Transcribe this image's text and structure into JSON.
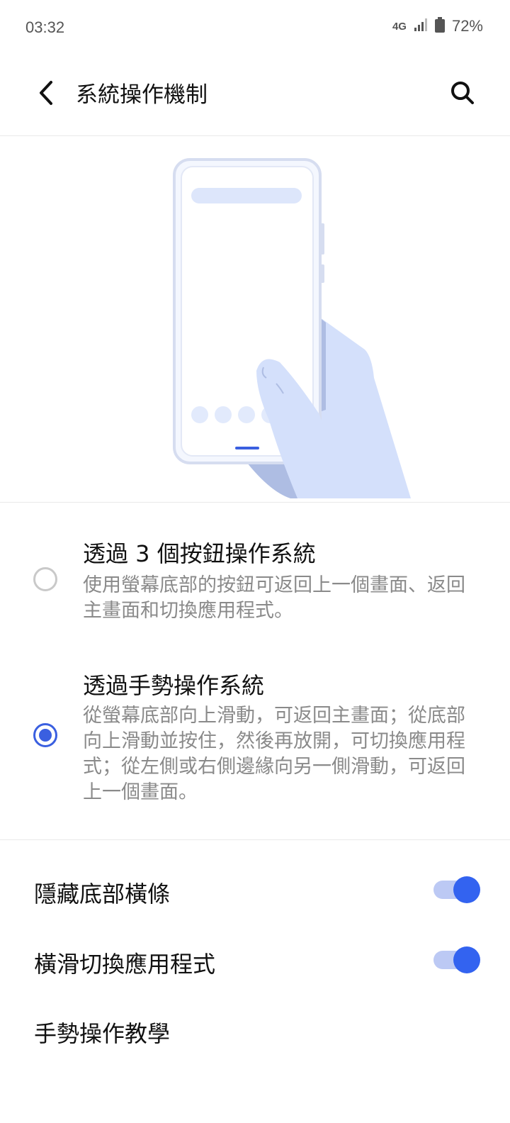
{
  "status_bar": {
    "time": "03:32",
    "network": "4G",
    "battery_percent": "72%"
  },
  "header": {
    "title": "系統操作機制",
    "back_icon": "chevron-left-icon",
    "search_icon": "search-icon"
  },
  "options": [
    {
      "title": "透過 3 個按鈕操作系統",
      "description": "使用螢幕底部的按鈕可返回上一個畫面、返回主畫面和切換應用程式。",
      "selected": false
    },
    {
      "title": "透過手勢操作系統",
      "description": "從螢幕底部向上滑動，可返回主畫面；從底部向上滑動並按住，然後再放開，可切換應用程式；從左側或右側邊緣向另一側滑動，可返回上一個畫面。",
      "selected": true
    }
  ],
  "settings": [
    {
      "label": "隱藏底部橫條",
      "enabled": true
    },
    {
      "label": "橫滑切換應用程式",
      "enabled": true
    },
    {
      "label": "手勢操作教學"
    }
  ],
  "colors": {
    "accent": "#3363f0",
    "illustration_fill": "#d4e0fb",
    "illustration_shadow": "#aebde3"
  }
}
